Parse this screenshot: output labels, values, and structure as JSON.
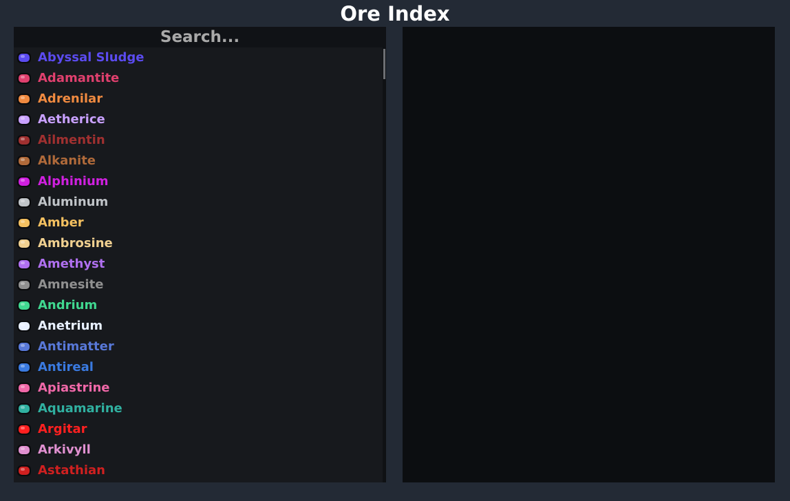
{
  "header": {
    "title": "Ore Index"
  },
  "search": {
    "placeholder": "Search..."
  },
  "ores": [
    {
      "name": "Abyssal Sludge",
      "color": "#5b4bf0",
      "icon": "sludge-icon"
    },
    {
      "name": "Adamantite",
      "color": "#e0406e",
      "icon": "gem-pair-icon"
    },
    {
      "name": "Adrenilar",
      "color": "#f08a40",
      "icon": "flame-icon"
    },
    {
      "name": "Aetherice",
      "color": "#c8a0ff",
      "icon": "crystal-icon"
    },
    {
      "name": "Ailmentin",
      "color": "#a03030",
      "icon": "shard-icon"
    },
    {
      "name": "Alkanite",
      "color": "#b06a3a",
      "icon": "rock-icon"
    },
    {
      "name": "Alphinium",
      "color": "#d020e0",
      "icon": "sparkle-icon"
    },
    {
      "name": "Aluminum",
      "color": "#c0c4c8",
      "icon": "ingot-icon"
    },
    {
      "name": "Amber",
      "color": "#f4c060",
      "icon": "bar-icon"
    },
    {
      "name": "Ambrosine",
      "color": "#f0d090",
      "icon": "cross-icon"
    },
    {
      "name": "Amethyst",
      "color": "#b070f0",
      "icon": "gem-icon"
    },
    {
      "name": "Amnesite",
      "color": "#909090",
      "icon": "feather-icon"
    },
    {
      "name": "Andrium",
      "color": "#40d890",
      "icon": "swirl-icon"
    },
    {
      "name": "Anetrium",
      "color": "#e8f0ff",
      "icon": "blade-icon"
    },
    {
      "name": "Antimatter",
      "color": "#5878d8",
      "icon": "crescent-icon"
    },
    {
      "name": "Antireal",
      "color": "#3a7ae0",
      "icon": "ring-icon"
    },
    {
      "name": "Apiastrine",
      "color": "#f068a8",
      "icon": "flower-icon"
    },
    {
      "name": "Aquamarine",
      "color": "#30b0a0",
      "icon": "droplet-icon"
    },
    {
      "name": "Argitar",
      "color": "#ff2020",
      "icon": "prism-icon"
    },
    {
      "name": "Arkivyll",
      "color": "#e090d0",
      "icon": "star-icon"
    },
    {
      "name": "Astathian",
      "color": "#d02020",
      "icon": "ember-icon"
    }
  ]
}
